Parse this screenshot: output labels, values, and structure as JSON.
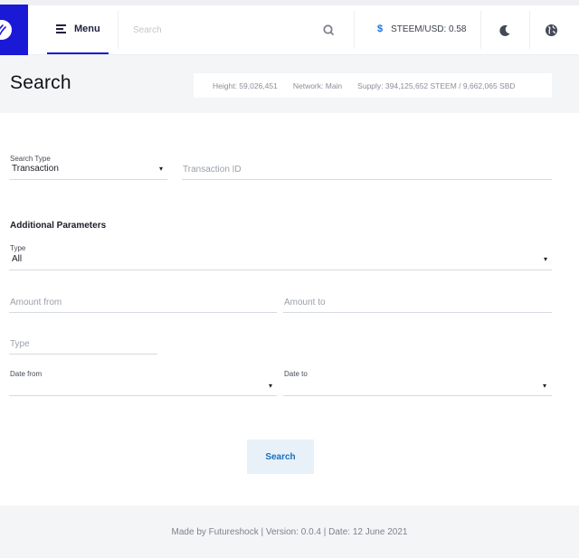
{
  "nav": {
    "menu_label": "Menu",
    "search_placeholder": "Search",
    "price_symbol": "$",
    "price_text": "STEEM/USD: 0.58"
  },
  "header": {
    "title": "Search",
    "stats": {
      "height": "Height: 59,026,451",
      "network": "Network: Main",
      "supply": "Supply: 394,125,652 STEEM / 9,662,065 SBD"
    }
  },
  "form": {
    "search_type_label": "Search Type",
    "search_type_value": "Transaction",
    "transaction_id_placeholder": "Transaction ID",
    "additional_heading": "Additional Parameters",
    "type_select_label": "Type",
    "type_select_value": "All",
    "amount_from_placeholder": "Amount from",
    "amount_to_placeholder": "Amount to",
    "type_input_placeholder": "Type",
    "date_from_label": "Date from",
    "date_to_label": "Date to",
    "search_button": "Search",
    "caret": "▾"
  },
  "footer": {
    "text": "Made by Futureshock |  Version: 0.0.4 | Date: 12 June 2021"
  },
  "colors": {
    "brand": "#1a1ad6",
    "accent": "#1a6fe0",
    "button_bg": "#e8f1f8",
    "band_bg": "#f4f5f7"
  },
  "icons": {
    "logo": "steem-logo-icon",
    "menu": "menu-lines-icon",
    "search": "search-icon",
    "dark_mode": "moon-icon",
    "language": "globe-icon"
  }
}
